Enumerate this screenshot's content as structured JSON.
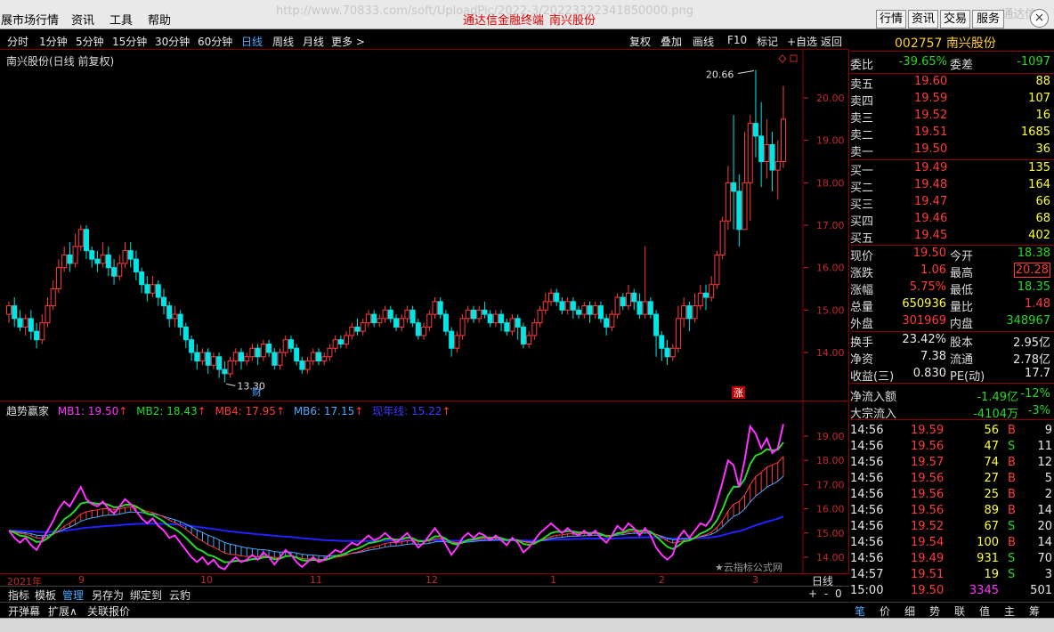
{
  "menubar": {
    "items": [
      "展市场行情",
      "资讯",
      "工具",
      "帮助"
    ],
    "url_fragment": "http://www.70833.com/soft/UploadPic/2022-3/20223322341850000.png",
    "url_right": "(通达信",
    "title": "通达信金融终端",
    "stock_title": "南兴股份",
    "right_buttons": [
      "行情",
      "资讯",
      "交易",
      "服务"
    ]
  },
  "period_bar": {
    "periods": [
      "分时",
      "1分钟",
      "5分钟",
      "15分钟",
      "30分钟",
      "60分钟",
      "日线",
      "周线",
      "月线",
      "更多 >"
    ],
    "active": "日线",
    "tools": [
      "复权",
      "叠加",
      "画线",
      "F10",
      "标记",
      "+自选",
      "返回"
    ]
  },
  "main_chart": {
    "title": "南兴股份(日线 前复权)",
    "price_axis": [
      "20.00",
      "19.00",
      "18.00",
      "17.00",
      "16.00",
      "15.00",
      "14.00"
    ],
    "high_mark": "20.66",
    "low_mark": "13.30",
    "badge_cai": "财",
    "badge_zhang": "涨"
  },
  "indicator": {
    "name": "趋势赢家",
    "mb1": "MB1: 19.50",
    "mb2": "MB2: 18.43",
    "mb4": "MB4: 17.95",
    "mb6": "MB6: 17.15",
    "yearline": "现年线: 15.22",
    "axis": [
      "19.00",
      "18.00",
      "17.00",
      "16.00",
      "15.00",
      "14.00"
    ],
    "watermark": "★云指标公式网"
  },
  "timeline": [
    "2021年",
    "9",
    "10",
    "11",
    "12",
    "1",
    "2",
    "3"
  ],
  "timeline_right": "日线",
  "bottom_bar1": [
    "指标",
    "模板",
    "管理",
    "另存为",
    "绑定到",
    "云豹"
  ],
  "bottom_bar1_active": "管理",
  "bottom_bar2": [
    "开弹幕",
    "扩展∧",
    "关联报价"
  ],
  "zoom_controls": "+ -  0",
  "right_panel": {
    "code": "002757 南兴股份",
    "weibi_label": "委比",
    "weibi": "-39.65%",
    "weicha_label": "委差",
    "weicha": "-1097",
    "asks": [
      {
        "label": "卖五",
        "price": "19.60",
        "vol": "88"
      },
      {
        "label": "卖四",
        "price": "19.59",
        "vol": "107"
      },
      {
        "label": "卖三",
        "price": "19.52",
        "vol": "16"
      },
      {
        "label": "卖二",
        "price": "19.51",
        "vol": "1685"
      },
      {
        "label": "卖一",
        "price": "19.50",
        "vol": "36"
      }
    ],
    "bids": [
      {
        "label": "买一",
        "price": "19.49",
        "vol": "135"
      },
      {
        "label": "买二",
        "price": "19.48",
        "vol": "164"
      },
      {
        "label": "买三",
        "price": "19.47",
        "vol": "66"
      },
      {
        "label": "买四",
        "price": "19.46",
        "vol": "68"
      },
      {
        "label": "买五",
        "price": "19.45",
        "vol": "402"
      }
    ],
    "quote": [
      {
        "l1": "现价",
        "v1": "19.50",
        "l2": "今开",
        "v2": "18.38"
      },
      {
        "l1": "涨跌",
        "v1": "1.06",
        "l2": "最高",
        "v2": "20.28"
      },
      {
        "l1": "涨幅",
        "v1": "5.75%",
        "l2": "最低",
        "v2": "18.35"
      },
      {
        "l1": "总量",
        "v1": "650936",
        "l2": "量比",
        "v2": "1.48"
      },
      {
        "l1": "外盘",
        "v1": "301969",
        "l2": "内盘",
        "v2": "348967"
      }
    ],
    "fund": [
      {
        "l1": "换手",
        "v1": "23.42%",
        "l2": "股本",
        "v2": "2.95亿"
      },
      {
        "l1": "净资",
        "v1": "7.38",
        "l2": "流通",
        "v2": "2.78亿"
      },
      {
        "l1": "收益(三)",
        "v1": "0.830",
        "l2": "PE(动)",
        "v2": "17.7"
      }
    ],
    "flow": [
      {
        "label": "净流入额",
        "v1": "-1.49亿",
        "v2": "-12%"
      },
      {
        "label": "大宗流入",
        "v1": "-4104万",
        "v2": "-3%"
      }
    ],
    "ticks": [
      {
        "time": "14:56",
        "price": "19.59",
        "vol": "56",
        "side": "B",
        "n": "9"
      },
      {
        "time": "14:56",
        "price": "19.56",
        "vol": "47",
        "side": "S",
        "n": "11"
      },
      {
        "time": "14:56",
        "price": "19.57",
        "vol": "74",
        "side": "B",
        "n": "12"
      },
      {
        "time": "14:56",
        "price": "19.56",
        "vol": "27",
        "side": "B",
        "n": "5"
      },
      {
        "time": "14:56",
        "price": "19.56",
        "vol": "25",
        "side": "B",
        "n": "2"
      },
      {
        "time": "14:56",
        "price": "19.56",
        "vol": "89",
        "side": "B",
        "n": "14"
      },
      {
        "time": "14:56",
        "price": "19.52",
        "vol": "67",
        "side": "S",
        "n": "20"
      },
      {
        "time": "14:56",
        "price": "19.54",
        "vol": "100",
        "side": "B",
        "n": "14"
      },
      {
        "time": "14:56",
        "price": "19.49",
        "vol": "931",
        "side": "S",
        "n": "70"
      },
      {
        "time": "14:57",
        "price": "19.51",
        "vol": "19",
        "side": "S",
        "n": "3"
      },
      {
        "time": "15:00",
        "price": "19.50",
        "vol": "3345",
        "side": "",
        "n": "501"
      }
    ],
    "tabs": [
      "笔",
      "价",
      "细",
      "势",
      "联",
      "值",
      "主",
      "筹"
    ],
    "active_tab": "笔"
  },
  "chart_data": {
    "type": "candlestick",
    "title": "南兴股份(日线 前复权)",
    "ylim": [
      13.3,
      20.66
    ],
    "candles": [
      [
        14.9,
        15.1,
        15.2,
        14.7
      ],
      [
        15.1,
        14.8,
        15.3,
        14.6
      ],
      [
        14.8,
        14.6,
        15.0,
        14.5
      ],
      [
        14.6,
        14.8,
        14.9,
        14.4
      ],
      [
        14.8,
        14.5,
        15.0,
        14.3
      ],
      [
        14.5,
        14.3,
        14.7,
        14.1
      ],
      [
        14.3,
        14.7,
        14.9,
        14.2
      ],
      [
        14.7,
        15.1,
        15.3,
        14.6
      ],
      [
        15.1,
        15.5,
        15.7,
        15.0
      ],
      [
        15.5,
        16.0,
        16.2,
        15.4
      ],
      [
        16.0,
        16.3,
        16.5,
        15.9
      ],
      [
        16.3,
        16.1,
        16.6,
        15.9
      ],
      [
        16.1,
        16.5,
        16.8,
        16.0
      ],
      [
        16.5,
        16.9,
        17.0,
        16.4
      ],
      [
        16.9,
        16.4,
        17.0,
        16.2
      ],
      [
        16.4,
        16.2,
        16.5,
        16.0
      ],
      [
        16.2,
        16.1,
        16.4,
        15.9
      ],
      [
        16.1,
        16.3,
        16.6,
        16.0
      ],
      [
        16.3,
        16.0,
        16.5,
        15.8
      ],
      [
        16.0,
        15.8,
        16.2,
        15.6
      ],
      [
        15.8,
        16.1,
        16.3,
        15.7
      ],
      [
        16.1,
        16.4,
        16.6,
        16.0
      ],
      [
        16.4,
        16.2,
        16.6,
        16.0
      ],
      [
        16.2,
        15.9,
        16.4,
        15.7
      ],
      [
        15.9,
        15.6,
        16.0,
        15.4
      ],
      [
        15.6,
        15.4,
        15.8,
        15.2
      ],
      [
        15.4,
        15.6,
        15.8,
        15.3
      ],
      [
        15.6,
        15.3,
        15.7,
        15.1
      ],
      [
        15.3,
        15.1,
        15.5,
        14.9
      ],
      [
        15.1,
        14.8,
        15.2,
        14.6
      ],
      [
        14.8,
        14.9,
        15.1,
        14.6
      ],
      [
        14.9,
        14.6,
        15.0,
        14.4
      ],
      [
        14.6,
        14.3,
        14.7,
        14.1
      ],
      [
        14.3,
        14.0,
        14.4,
        13.8
      ],
      [
        14.0,
        13.8,
        14.2,
        13.6
      ],
      [
        13.8,
        14.0,
        14.1,
        13.7
      ],
      [
        14.0,
        13.7,
        14.1,
        13.5
      ],
      [
        13.7,
        13.9,
        14.0,
        13.6
      ],
      [
        13.9,
        13.6,
        14.0,
        13.4
      ],
      [
        13.6,
        13.5,
        13.8,
        13.3
      ],
      [
        13.5,
        13.8,
        13.9,
        13.4
      ],
      [
        13.8,
        14.0,
        14.1,
        13.7
      ],
      [
        14.0,
        13.8,
        14.1,
        13.6
      ],
      [
        13.8,
        13.9,
        14.0,
        13.7
      ],
      [
        13.9,
        14.1,
        14.2,
        13.8
      ],
      [
        14.1,
        13.9,
        14.2,
        13.7
      ],
      [
        13.9,
        14.2,
        14.3,
        13.8
      ],
      [
        14.2,
        14.0,
        14.3,
        13.9
      ],
      [
        14.0,
        13.7,
        14.1,
        13.6
      ],
      [
        13.7,
        14.0,
        14.1,
        13.6
      ],
      [
        14.0,
        14.3,
        14.4,
        13.9
      ],
      [
        14.3,
        14.1,
        14.4,
        14.0
      ],
      [
        14.1,
        13.8,
        14.2,
        13.7
      ],
      [
        13.8,
        13.6,
        13.9,
        13.5
      ],
      [
        13.6,
        13.8,
        13.9,
        13.5
      ],
      [
        13.8,
        14.0,
        14.1,
        13.7
      ],
      [
        14.0,
        13.8,
        14.1,
        13.7
      ],
      [
        13.8,
        13.9,
        14.0,
        13.7
      ],
      [
        13.9,
        14.1,
        14.2,
        13.8
      ],
      [
        14.1,
        14.3,
        14.4,
        14.0
      ],
      [
        14.3,
        14.2,
        14.4,
        14.1
      ],
      [
        14.2,
        14.4,
        14.5,
        14.1
      ],
      [
        14.4,
        14.6,
        14.7,
        14.3
      ],
      [
        14.6,
        14.5,
        14.8,
        14.4
      ],
      [
        14.5,
        14.7,
        14.8,
        14.4
      ],
      [
        14.7,
        14.9,
        15.0,
        14.6
      ],
      [
        14.9,
        14.7,
        15.0,
        14.6
      ],
      [
        14.7,
        14.8,
        14.9,
        14.6
      ],
      [
        14.8,
        15.0,
        15.1,
        14.7
      ],
      [
        15.0,
        14.8,
        15.1,
        14.7
      ],
      [
        14.8,
        14.6,
        14.9,
        14.5
      ],
      [
        14.6,
        14.8,
        14.9,
        14.5
      ],
      [
        14.8,
        15.0,
        15.1,
        14.7
      ],
      [
        15.0,
        14.7,
        15.1,
        14.6
      ],
      [
        14.7,
        14.4,
        14.8,
        14.3
      ],
      [
        14.4,
        14.6,
        14.7,
        14.3
      ],
      [
        14.6,
        14.9,
        15.0,
        14.5
      ],
      [
        14.9,
        15.2,
        15.3,
        14.8
      ],
      [
        15.2,
        14.9,
        15.3,
        14.8
      ],
      [
        14.9,
        14.5,
        15.0,
        14.4
      ],
      [
        14.5,
        14.1,
        14.6,
        13.9
      ],
      [
        14.1,
        14.4,
        14.5,
        14.0
      ],
      [
        14.4,
        14.8,
        14.9,
        14.3
      ],
      [
        14.8,
        15.0,
        15.1,
        14.7
      ],
      [
        15.0,
        14.8,
        15.1,
        14.7
      ],
      [
        14.8,
        15.0,
        15.1,
        14.7
      ],
      [
        15.0,
        14.9,
        15.2,
        14.8
      ],
      [
        14.9,
        14.7,
        15.0,
        14.6
      ],
      [
        14.7,
        14.9,
        15.0,
        14.6
      ],
      [
        14.9,
        14.7,
        15.0,
        14.5
      ],
      [
        14.7,
        14.5,
        14.8,
        14.4
      ],
      [
        14.5,
        14.8,
        14.9,
        14.4
      ],
      [
        14.8,
        14.6,
        14.9,
        14.3
      ],
      [
        14.6,
        14.2,
        14.7,
        14.1
      ],
      [
        14.2,
        14.4,
        14.5,
        14.1
      ],
      [
        14.4,
        14.7,
        14.8,
        14.3
      ],
      [
        14.7,
        15.0,
        15.1,
        14.6
      ],
      [
        15.0,
        15.2,
        15.4,
        14.9
      ],
      [
        15.2,
        15.4,
        15.5,
        15.1
      ],
      [
        15.4,
        15.2,
        15.5,
        15.1
      ],
      [
        15.2,
        15.0,
        15.3,
        14.9
      ],
      [
        15.0,
        15.2,
        15.3,
        14.9
      ],
      [
        15.2,
        15.0,
        15.3,
        14.8
      ],
      [
        15.0,
        14.9,
        15.1,
        14.8
      ],
      [
        14.9,
        15.1,
        15.2,
        14.8
      ],
      [
        15.1,
        14.9,
        15.2,
        14.7
      ],
      [
        14.9,
        15.1,
        15.2,
        14.8
      ],
      [
        15.1,
        14.8,
        15.2,
        14.7
      ],
      [
        14.8,
        14.6,
        14.9,
        14.4
      ],
      [
        14.6,
        14.9,
        15.0,
        14.5
      ],
      [
        14.9,
        15.3,
        15.4,
        14.8
      ],
      [
        15.3,
        15.1,
        15.4,
        15.0
      ],
      [
        15.1,
        15.4,
        15.6,
        15.0
      ],
      [
        15.4,
        15.2,
        15.5,
        15.0
      ],
      [
        15.2,
        14.9,
        15.4,
        14.8
      ],
      [
        14.9,
        15.2,
        16.5,
        14.8
      ],
      [
        15.2,
        14.9,
        15.3,
        14.8
      ],
      [
        14.9,
        14.4,
        15.0,
        13.9
      ],
      [
        14.4,
        14.1,
        14.5,
        13.8
      ],
      [
        14.1,
        13.9,
        14.3,
        13.7
      ],
      [
        13.9,
        14.1,
        14.2,
        13.8
      ],
      [
        14.1,
        14.8,
        15.1,
        14.0
      ],
      [
        14.8,
        15.1,
        15.3,
        14.6
      ],
      [
        15.1,
        14.8,
        15.2,
        14.5
      ],
      [
        14.8,
        15.1,
        15.4,
        14.7
      ],
      [
        15.1,
        15.4,
        15.6,
        15.0
      ],
      [
        15.4,
        15.3,
        15.6,
        15.0
      ],
      [
        15.3,
        15.6,
        15.8,
        15.2
      ],
      [
        15.6,
        16.3,
        16.4,
        15.5
      ],
      [
        16.3,
        17.1,
        17.2,
        16.2
      ],
      [
        17.1,
        18.0,
        18.4,
        16.9
      ],
      [
        18.0,
        17.8,
        19.6,
        16.9
      ],
      [
        17.8,
        16.9,
        18.2,
        16.5
      ],
      [
        16.9,
        18.0,
        19.2,
        16.9
      ],
      [
        18.0,
        19.4,
        19.6,
        17.1
      ],
      [
        19.4,
        19.1,
        20.66,
        18.6
      ],
      [
        19.1,
        18.5,
        19.9,
        17.9
      ],
      [
        18.5,
        18.9,
        19.5,
        18.1
      ],
      [
        18.9,
        18.3,
        19.2,
        17.8
      ],
      [
        18.3,
        18.5,
        19.0,
        17.6
      ],
      [
        18.5,
        19.5,
        20.28,
        18.35
      ]
    ]
  }
}
